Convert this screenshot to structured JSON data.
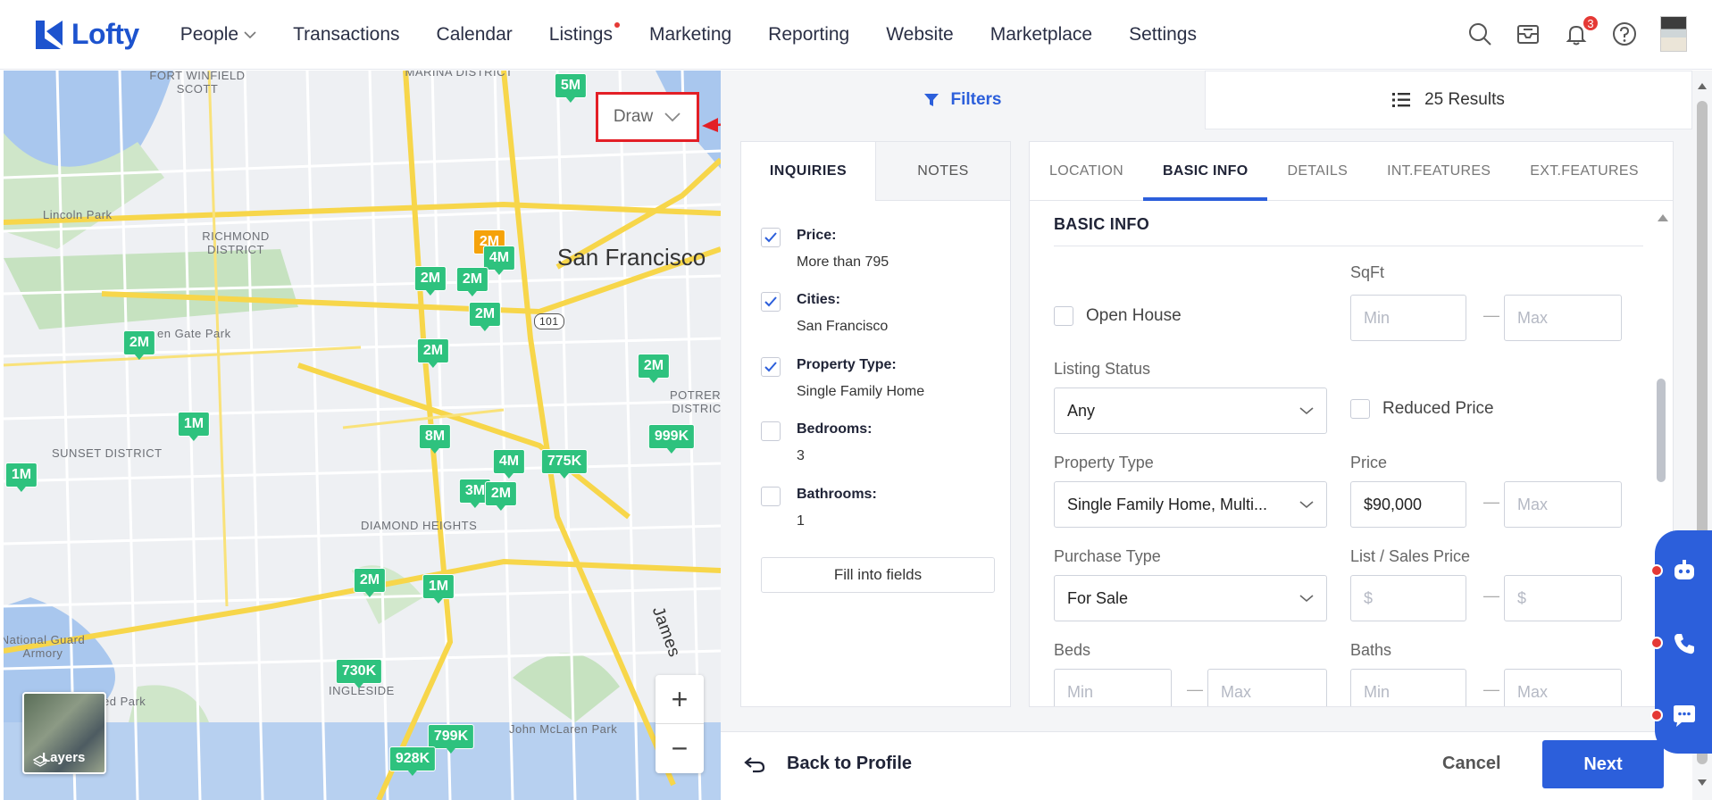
{
  "nav": {
    "brand": "Lofty",
    "items": [
      {
        "label": "People"
      },
      {
        "label": "Transactions"
      },
      {
        "label": "Calendar"
      },
      {
        "label": "Listings"
      },
      {
        "label": "Marketing"
      },
      {
        "label": "Reporting"
      },
      {
        "label": "Website"
      },
      {
        "label": "Marketplace"
      },
      {
        "label": "Settings"
      }
    ],
    "notification_count": "3",
    "icons": [
      "search-icon",
      "inbox-icon",
      "bell-icon",
      "help-icon",
      "avatar"
    ]
  },
  "map": {
    "draw_label": "Draw",
    "layers_label": "Layers",
    "city_label": "San Francisco",
    "district_labels": [
      "FORT WINFIELD SCOTT",
      "MARINA DISTRICT",
      "Lincoln Park",
      "RICHMOND DISTRICT",
      "en Gate Park",
      "SUNSET DISTRICT",
      "DIAMOND HEIGHTS",
      "POTRERO DISTRIC",
      "National Guard Armory",
      "ced Park",
      "INGLESIDE",
      "John McLaren Park",
      "James",
      "101"
    ],
    "pins": [
      {
        "label": "5M",
        "color": "green"
      },
      {
        "label": "2M",
        "color": "orange"
      },
      {
        "label": "4M",
        "color": "green"
      },
      {
        "label": "2M",
        "color": "green"
      },
      {
        "label": "2M",
        "color": "green"
      },
      {
        "label": "2M",
        "color": "green"
      },
      {
        "label": "2M",
        "color": "green"
      },
      {
        "label": "2M",
        "color": "green"
      },
      {
        "label": "2M",
        "color": "green"
      },
      {
        "label": "1M",
        "color": "green"
      },
      {
        "label": "999K",
        "color": "green"
      },
      {
        "label": "8M",
        "color": "green"
      },
      {
        "label": "4M",
        "color": "green"
      },
      {
        "label": "775K",
        "color": "green"
      },
      {
        "label": "3M",
        "color": "green"
      },
      {
        "label": "2M",
        "color": "green"
      },
      {
        "label": "1M",
        "color": "green"
      },
      {
        "label": "2M",
        "color": "green"
      },
      {
        "label": "1M",
        "color": "green"
      },
      {
        "label": "730K",
        "color": "green"
      },
      {
        "label": "799K",
        "color": "green"
      },
      {
        "label": "928K",
        "color": "green"
      }
    ]
  },
  "panel": {
    "filters_label": "Filters",
    "results_label": "25 Results",
    "inquiries": {
      "tabs": [
        "INQUIRIES",
        "NOTES"
      ],
      "criteria": [
        {
          "title": "Price:",
          "value": "More than 795",
          "checked": true
        },
        {
          "title": "Cities:",
          "value": "San Francisco",
          "checked": true
        },
        {
          "title": "Property Type:",
          "value": "Single Family Home",
          "checked": true
        },
        {
          "title": "Bedrooms:",
          "value": "3",
          "checked": false
        },
        {
          "title": "Bathrooms:",
          "value": "1",
          "checked": false
        }
      ],
      "fill_button": "Fill into fields"
    },
    "basic": {
      "tabs": [
        "LOCATION",
        "BASIC INFO",
        "DETAILS",
        "INT.FEATURES",
        "EXT.FEATURES"
      ],
      "section_title": "BASIC INFO",
      "open_house_label": "Open House",
      "sqft_label": "SqFt",
      "sqft_min_placeholder": "Min",
      "sqft_max_placeholder": "Max",
      "listing_status_label": "Listing Status",
      "listing_status_value": "Any",
      "reduced_price_label": "Reduced Price",
      "property_type_label": "Property Type",
      "property_type_value": "Single Family Home, Multi...",
      "price_label": "Price",
      "price_min_value": "$90,000",
      "price_max_placeholder": "Max",
      "purchase_type_label": "Purchase Type",
      "purchase_type_value": "For Sale",
      "list_sales_label": "List / Sales Price",
      "list_min_placeholder": "$",
      "list_max_placeholder": "$",
      "beds_label": "Beds",
      "beds_min_placeholder": "Min",
      "beds_max_placeholder": "Max",
      "baths_label": "Baths",
      "baths_min_placeholder": "Min",
      "baths_max_placeholder": "Max",
      "range_dash": "—"
    },
    "footer": {
      "back_label": "Back to Profile",
      "cancel_label": "Cancel",
      "next_label": "Next"
    }
  },
  "colors": {
    "brand": "#1d53ce",
    "accent": "#2c5fdb",
    "pin_green": "#2ec27e",
    "pin_orange": "#f5a20a",
    "highlight_red": "#e31f26"
  }
}
